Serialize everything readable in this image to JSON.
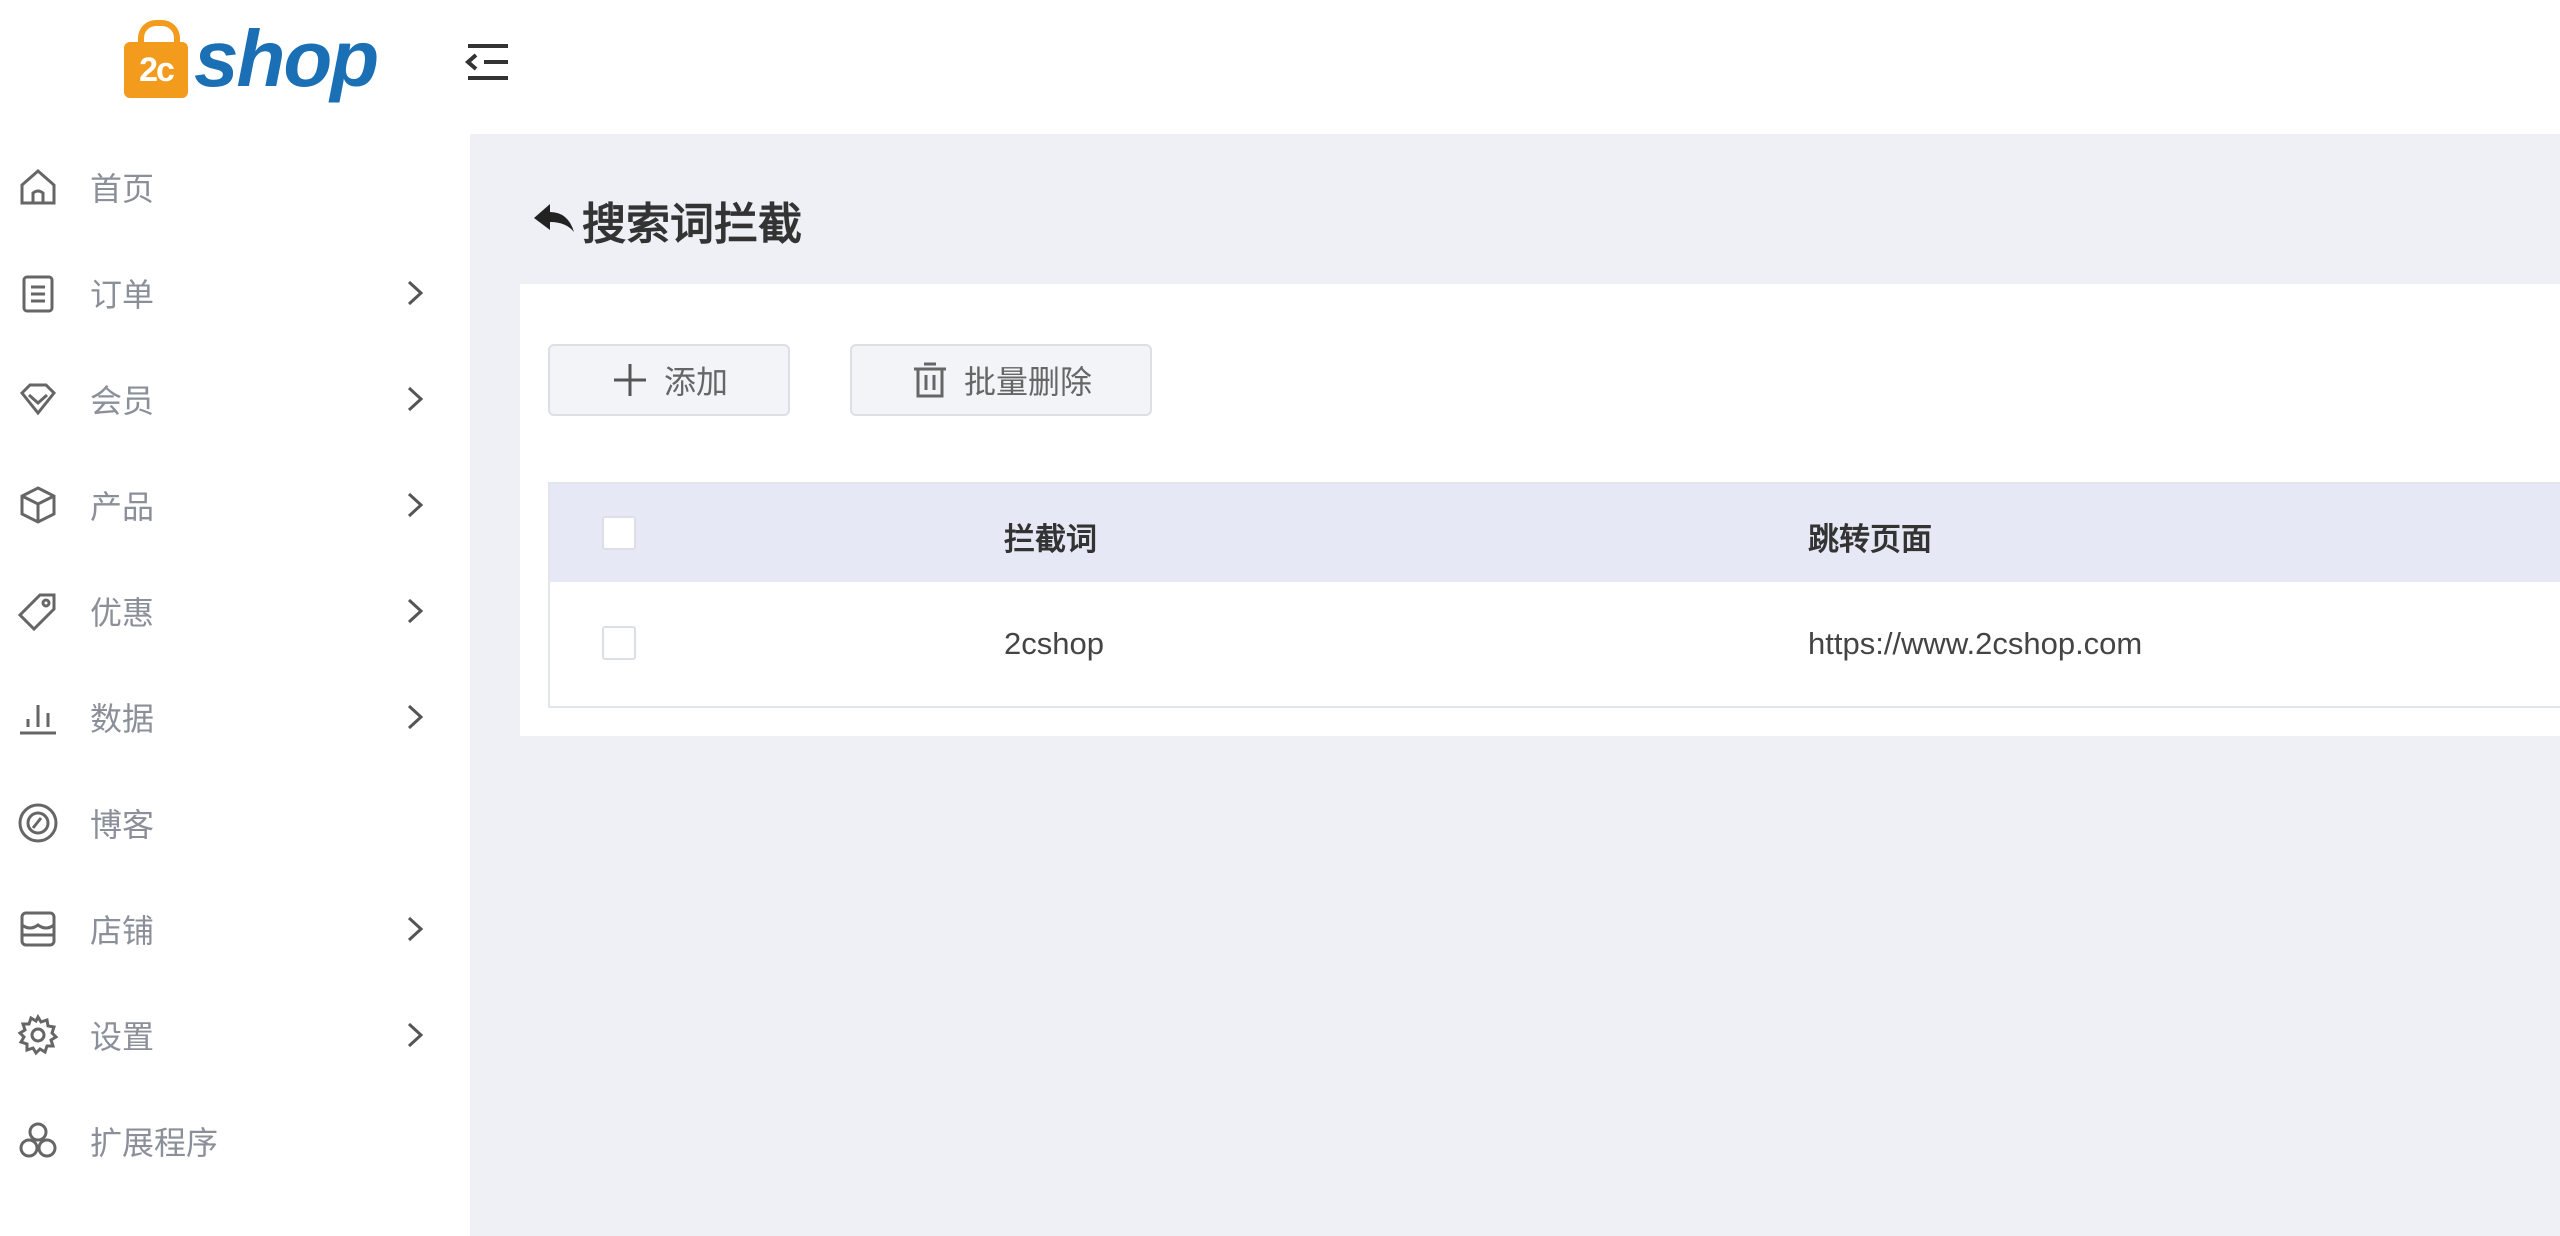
{
  "header": {
    "logo_mark": "2c",
    "logo_text": "shop",
    "menu_toggle_icon": "menu-collapse-icon"
  },
  "sidebar": {
    "items": [
      {
        "label": "首页",
        "icon": "home-icon",
        "has_submenu": false
      },
      {
        "label": "订单",
        "icon": "clipboard-icon",
        "has_submenu": true
      },
      {
        "label": "会员",
        "icon": "diamond-icon",
        "has_submenu": true
      },
      {
        "label": "产品",
        "icon": "box-icon",
        "has_submenu": true
      },
      {
        "label": "优惠",
        "icon": "tag-icon",
        "has_submenu": true
      },
      {
        "label": "数据",
        "icon": "bar-chart-icon",
        "has_submenu": true
      },
      {
        "label": "博客",
        "icon": "blog-icon",
        "has_submenu": false
      },
      {
        "label": "店铺",
        "icon": "store-icon",
        "has_submenu": true
      },
      {
        "label": "设置",
        "icon": "gear-icon",
        "has_submenu": true
      },
      {
        "label": "扩展程序",
        "icon": "extensions-icon",
        "has_submenu": false
      }
    ]
  },
  "main": {
    "title": "搜索词拦截",
    "toolbar": {
      "add_label": "添加",
      "bulk_delete_label": "批量删除"
    },
    "table": {
      "columns": [
        "拦截词",
        "跳转页面"
      ],
      "rows": [
        {
          "keyword": "2cshop",
          "redirect": "https://www.2cshop.com"
        }
      ]
    }
  },
  "colors": {
    "brand_orange": "#f29b1d",
    "brand_blue": "#1b6fb5",
    "content_bg": "#eef0f5",
    "table_header_bg": "#e6e9f5"
  }
}
